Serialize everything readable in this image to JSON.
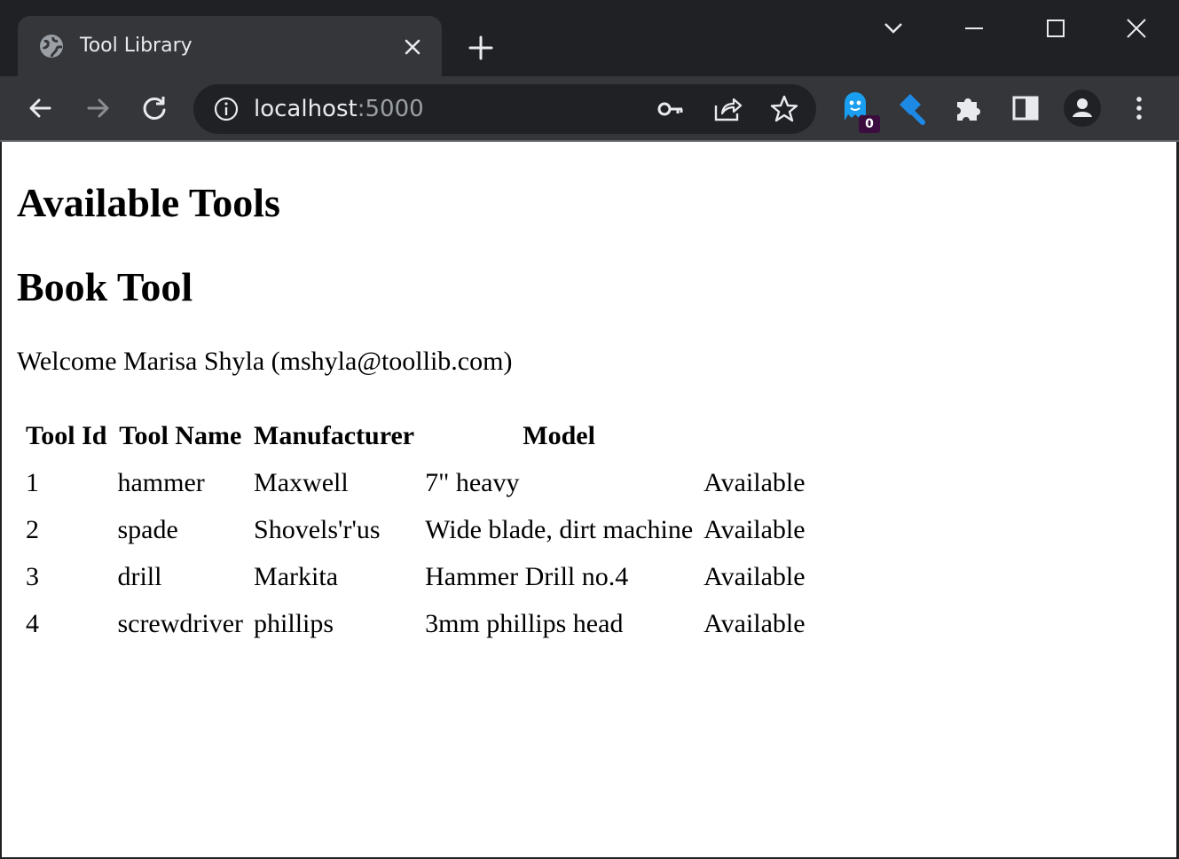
{
  "browser": {
    "tab_title": "Tool Library",
    "url_host": "localhost",
    "url_port": ":5000",
    "extension_badge": "0"
  },
  "page": {
    "heading_available": "Available Tools",
    "heading_book": "Book Tool",
    "welcome": "Welcome Marisa Shyla (mshyla@toollib.com)",
    "table": {
      "headers": [
        "Tool Id",
        "Tool Name",
        "Manufacturer",
        "Model",
        ""
      ],
      "rows": [
        [
          "1",
          "hammer",
          "Maxwell",
          "7\" heavy",
          "Available"
        ],
        [
          "2",
          "spade",
          "Shovels'r'us",
          "Wide blade, dirt machine",
          "Available"
        ],
        [
          "3",
          "drill",
          "Markita",
          "Hammer Drill no.4",
          "Available"
        ],
        [
          "4",
          "screwdriver",
          "phillips",
          "3mm phillips head",
          "Available"
        ]
      ]
    }
  },
  "colors": {
    "frame": "#202124",
    "toolbar": "#35363a",
    "text_light": "#e8eaed",
    "port_text": "#9aa0a6",
    "ghost_ext": "#1a9ef0",
    "pen_ext": "#1e88e5",
    "badge": "#3b0d3f"
  },
  "icons": {
    "favicon": "globe-icon",
    "close": "close-icon",
    "new_tab": "plus-icon",
    "back": "back-arrow-icon",
    "forward": "forward-arrow-icon",
    "reload": "reload-icon",
    "info": "info-icon",
    "password": "key-icon",
    "share": "share-icon",
    "bookmark": "star-icon",
    "ghost_extension": "ghost-icon",
    "pen_extension": "pen-icon",
    "extensions": "puzzle-icon",
    "side_panel": "side-panel-icon",
    "profile": "profile-icon",
    "menu": "kebab-menu-icon"
  }
}
